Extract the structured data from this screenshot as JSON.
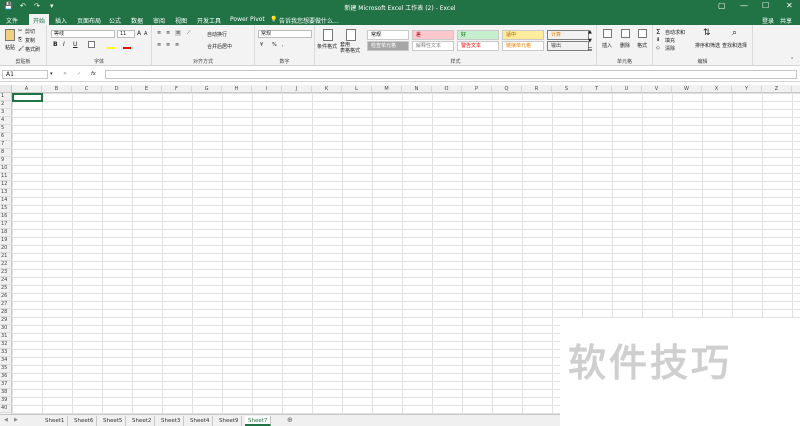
{
  "window": {
    "title": "新建 Microsoft Excel 工作表 (2) - Excel"
  },
  "quick_access": {
    "save": "💾",
    "undo": "↶",
    "redo": "↷",
    "more": "▾"
  },
  "window_controls": {
    "restore": "▢",
    "minimize": "—",
    "maximize": "☐",
    "close": "✕"
  },
  "account": {
    "login": "登录",
    "share": "共享"
  },
  "tabs": [
    "文件",
    "开始",
    "插入",
    "页面布局",
    "公式",
    "数据",
    "审阅",
    "视图",
    "开发工具",
    "Power Pivot"
  ],
  "tell_me": "告诉我您想要做什么...",
  "clipboard": {
    "paste": "粘贴",
    "cut": "剪切",
    "copy": "复制",
    "format_painter": "格式刷",
    "label": "剪贴板"
  },
  "font": {
    "name": "等线",
    "size": "11",
    "grow": "A",
    "shrink": "A",
    "bold": "B",
    "italic": "I",
    "underline": "U",
    "label": "字体"
  },
  "alignment": {
    "wrap": "自动换行",
    "merge": "合并后居中",
    "label": "对齐方式"
  },
  "number": {
    "format": "常规",
    "percent": "%",
    "comma": ",",
    "label": "数字"
  },
  "styles": {
    "cond_format": "条件格式",
    "table_format": "套用\n表格格式",
    "label": "样式",
    "cells": [
      {
        "text": "常规",
        "bg": "#ffffff",
        "fg": "#000000"
      },
      {
        "text": "差",
        "bg": "#ffc7ce",
        "fg": "#9c0006"
      },
      {
        "text": "好",
        "bg": "#c6efce",
        "fg": "#006100"
      },
      {
        "text": "适中",
        "bg": "#ffeb9c",
        "fg": "#9c6500"
      },
      {
        "text": "计算",
        "bg": "#f2f2f2",
        "fg": "#fa7d00"
      },
      {
        "text": "检查单元格",
        "bg": "#a5a5a5",
        "fg": "#ffffff"
      },
      {
        "text": "解释性文本",
        "bg": "#ffffff",
        "fg": "#7f7f7f"
      },
      {
        "text": "警告文本",
        "bg": "#ffffff",
        "fg": "#ff0000"
      },
      {
        "text": "链接单元格",
        "bg": "#ffffff",
        "fg": "#fa7d00"
      },
      {
        "text": "输出",
        "bg": "#f2f2f2",
        "fg": "#3f3f3f"
      }
    ]
  },
  "cells": {
    "insert": "插入",
    "delete": "删除",
    "format": "格式",
    "label": "单元格"
  },
  "editing": {
    "autosum": "自动求和",
    "fill": "填充",
    "clear": "清除",
    "sort": "排序和筛选",
    "find": "查找和选择",
    "label": "编辑"
  },
  "formula_bar": {
    "name_box": "A1",
    "cancel": "✕",
    "enter": "✓",
    "fx": "fx"
  },
  "columns": [
    "A",
    "B",
    "C",
    "D",
    "E",
    "F",
    "G",
    "H",
    "I",
    "J",
    "K",
    "L",
    "M",
    "N",
    "O",
    "P",
    "Q",
    "R",
    "S",
    "T",
    "U",
    "V",
    "W",
    "X",
    "Y",
    "Z"
  ],
  "sheets": [
    "Sheet1",
    "Sheet6",
    "Sheet5",
    "Sheet2",
    "Sheet3",
    "Sheet4",
    "Sheet9",
    "Sheet7"
  ],
  "active_sheet": "Sheet7",
  "add_sheet": "⊕",
  "watermark": "软件技巧"
}
